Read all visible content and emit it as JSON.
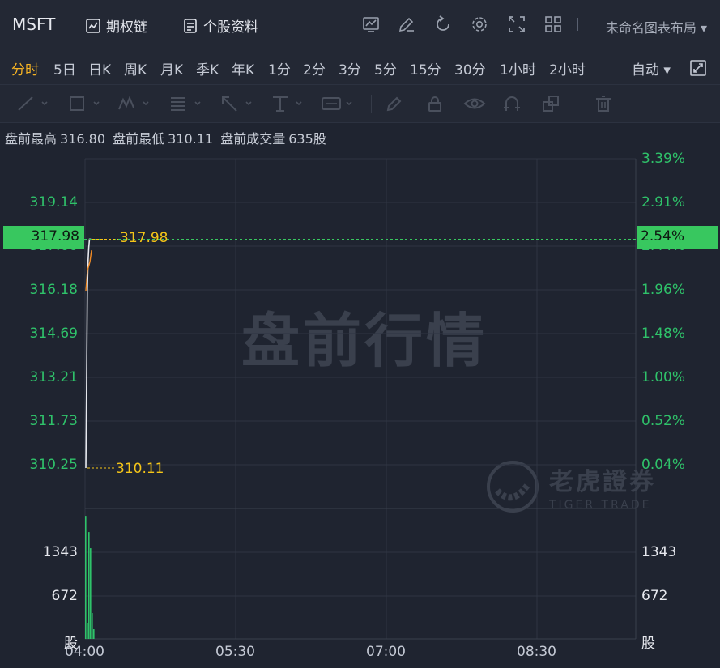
{
  "header": {
    "ticker": "MSFT",
    "options_chain": "期权链",
    "profile": "个股资料",
    "layout_name": "未命名图表布局"
  },
  "periods": [
    "分时",
    "5日",
    "日K",
    "周K",
    "月K",
    "季K",
    "年K",
    "1分",
    "2分",
    "3分",
    "5分",
    "15分",
    "30分",
    "1小时",
    "2小时"
  ],
  "active_period": "分时",
  "price_mode": "自动",
  "info": {
    "high_label": "盘前最高",
    "high_value": "316.80",
    "low_label": "盘前最低",
    "low_value": "310.11",
    "vol_label": "盘前成交量",
    "vol_value": "635股"
  },
  "watermark": "盘前行情",
  "brand": {
    "name": "老虎證券",
    "sub": "TIGER TRADE"
  },
  "colors": {
    "up": "#2fc26a",
    "active": "#f5b324",
    "marker": "#f5c518",
    "bg": "#1f2430",
    "grid": "#2f3542"
  },
  "chart_data": {
    "type": "line",
    "price_axis": [
      "319.14",
      "317.66",
      "316.18",
      "314.69",
      "313.21",
      "311.73",
      "310.25"
    ],
    "pct_axis": [
      "3.39%",
      "2.91%",
      "2.44%",
      "1.96%",
      "1.48%",
      "1.00%",
      "0.52%",
      "0.04%"
    ],
    "current_price": "317.98",
    "current_pct": "2.54%",
    "high_marker": "317.98",
    "low_marker": "310.11",
    "x_ticks": [
      "04:00",
      "05:30",
      "07:00",
      "08:30"
    ],
    "volume_axis": [
      "1343",
      "672"
    ],
    "volume_unit": "股",
    "price_range": [
      310.11,
      320.75
    ],
    "series": [
      {
        "x": [
          0,
          1,
          2,
          3,
          4,
          5,
          6,
          7
        ],
        "y": [
          310.11,
          313.0,
          316.2,
          317.2,
          317.7,
          317.98,
          317.98,
          317.98
        ]
      }
    ],
    "volume_range": [
      0,
      2014
    ],
    "volume": [
      1900,
      250,
      1650,
      1400,
      400,
      150
    ]
  }
}
